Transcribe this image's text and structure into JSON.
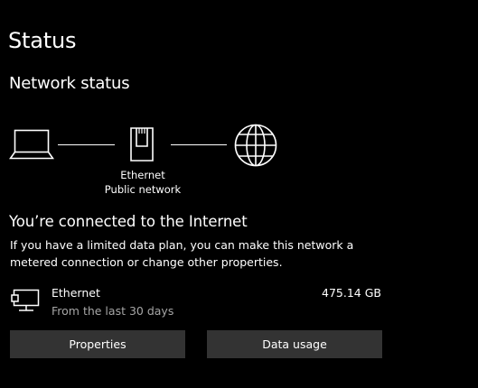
{
  "page": {
    "title": "Status"
  },
  "network_status": {
    "heading": "Network status",
    "diagram": {
      "nodes": [
        {
          "name": "computer",
          "icon": "laptop-icon"
        },
        {
          "name": "adapter",
          "icon": "ethernet-port-icon",
          "label_line1": "Ethernet",
          "label_line2": "Public network"
        },
        {
          "name": "internet",
          "icon": "globe-icon"
        }
      ]
    }
  },
  "connection": {
    "heading": "You’re connected to the Internet",
    "description": "If you have a limited data plan, you can make this network a metered connection or change other properties."
  },
  "adapter": {
    "icon": "ethernet-adapter-icon",
    "name": "Ethernet",
    "period": "From the last 30 days",
    "usage": "475.14 GB"
  },
  "actions": {
    "properties_label": "Properties",
    "data_usage_label": "Data usage"
  },
  "colors": {
    "background": "#000000",
    "text": "#ffffff",
    "secondary_text": "#a6a6a6",
    "button_bg": "#333333"
  }
}
